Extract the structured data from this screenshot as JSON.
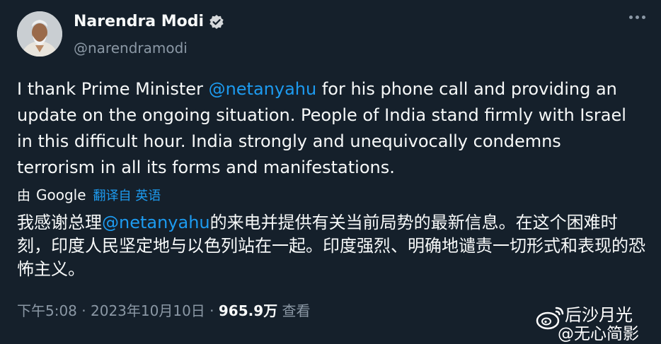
{
  "author": {
    "name": "Narendra Modi",
    "handle": "@narendramodi"
  },
  "tweet": {
    "text_before": "I thank Prime Minister ",
    "mention": "@netanyahu",
    "text_after": " for his phone call and providing an update on the ongoing situation. People of India stand firmly with Israel in this difficult hour. India strongly and unequivocally condemns terrorism in all its forms and manifestations."
  },
  "translation": {
    "by_label": "由",
    "provider": "Google",
    "link_label": "翻译自 英语",
    "text_before": "我感谢总理",
    "mention": "@netanyahu",
    "text_after": "的来电并提供有关当前局势的最新信息。在这个困难时刻，印度人民坚定地与以色列站在一起。印度强烈、明确地谴责一切形式和表现的恐怖主义。"
  },
  "meta": {
    "time": "下午5:08",
    "date": "2023年10月10日",
    "views_count": "965.9万",
    "views_label": "查看",
    "separator": "·"
  },
  "watermark": {
    "line1": "后沙月光",
    "line2": "@无心简影"
  },
  "colors": {
    "background": "#15202b",
    "text": "#f7f9f9",
    "secondary": "#8b98a5",
    "link": "#1d9bf0",
    "verified": "#1d9bf0"
  }
}
